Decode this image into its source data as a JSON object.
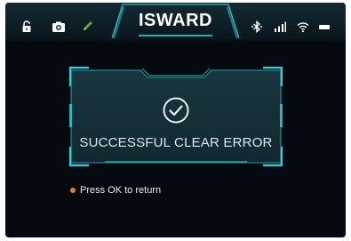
{
  "status_bar": {
    "title": "ISWARD",
    "left_icons": [
      "lock-open-icon",
      "camera-icon",
      "edit-pen-icon"
    ],
    "right_icons": [
      "bluetooth-icon",
      "signal-bars-icon",
      "wifi-icon",
      "battery-icon"
    ]
  },
  "dialog": {
    "icon": "check-circle-icon",
    "message": "SUCCESSFUL CLEAR ERROR"
  },
  "hint": {
    "text": "Press OK to return",
    "bullet_color": "#f0782a"
  },
  "colors": {
    "accent": "#2fd0d8",
    "background": "#040a10",
    "status_bar": "#152a33",
    "dialog_fill": "#163037",
    "pen_green": "#5ea83c"
  }
}
